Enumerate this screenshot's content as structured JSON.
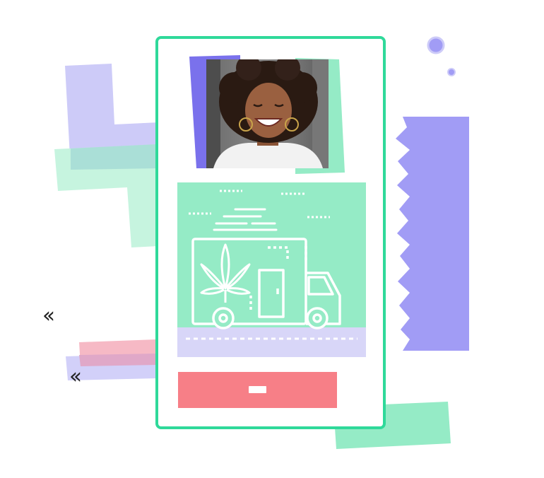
{
  "colors": {
    "card_border": "#2fd99a",
    "mint": "#95ebc6",
    "mint_light": "#c3f3dd",
    "lavender": "#a19cf5",
    "lavender_light": "#cdcbf8",
    "purple_strip": "#7a71ec",
    "pink": "#f77f87",
    "pink_light": "#f6b9c5",
    "road": "#d8d6f8"
  },
  "icons": {
    "chevrons_top": "double-chevron-left-icon",
    "chevrons_bottom": "double-chevron-left-icon",
    "truck": "delivery-truck-icon",
    "leaf": "cannabis-leaf-icon"
  },
  "card": {
    "photo": {
      "subject": "smiling-woman-photo"
    },
    "cta_button": {
      "label": ""
    }
  }
}
